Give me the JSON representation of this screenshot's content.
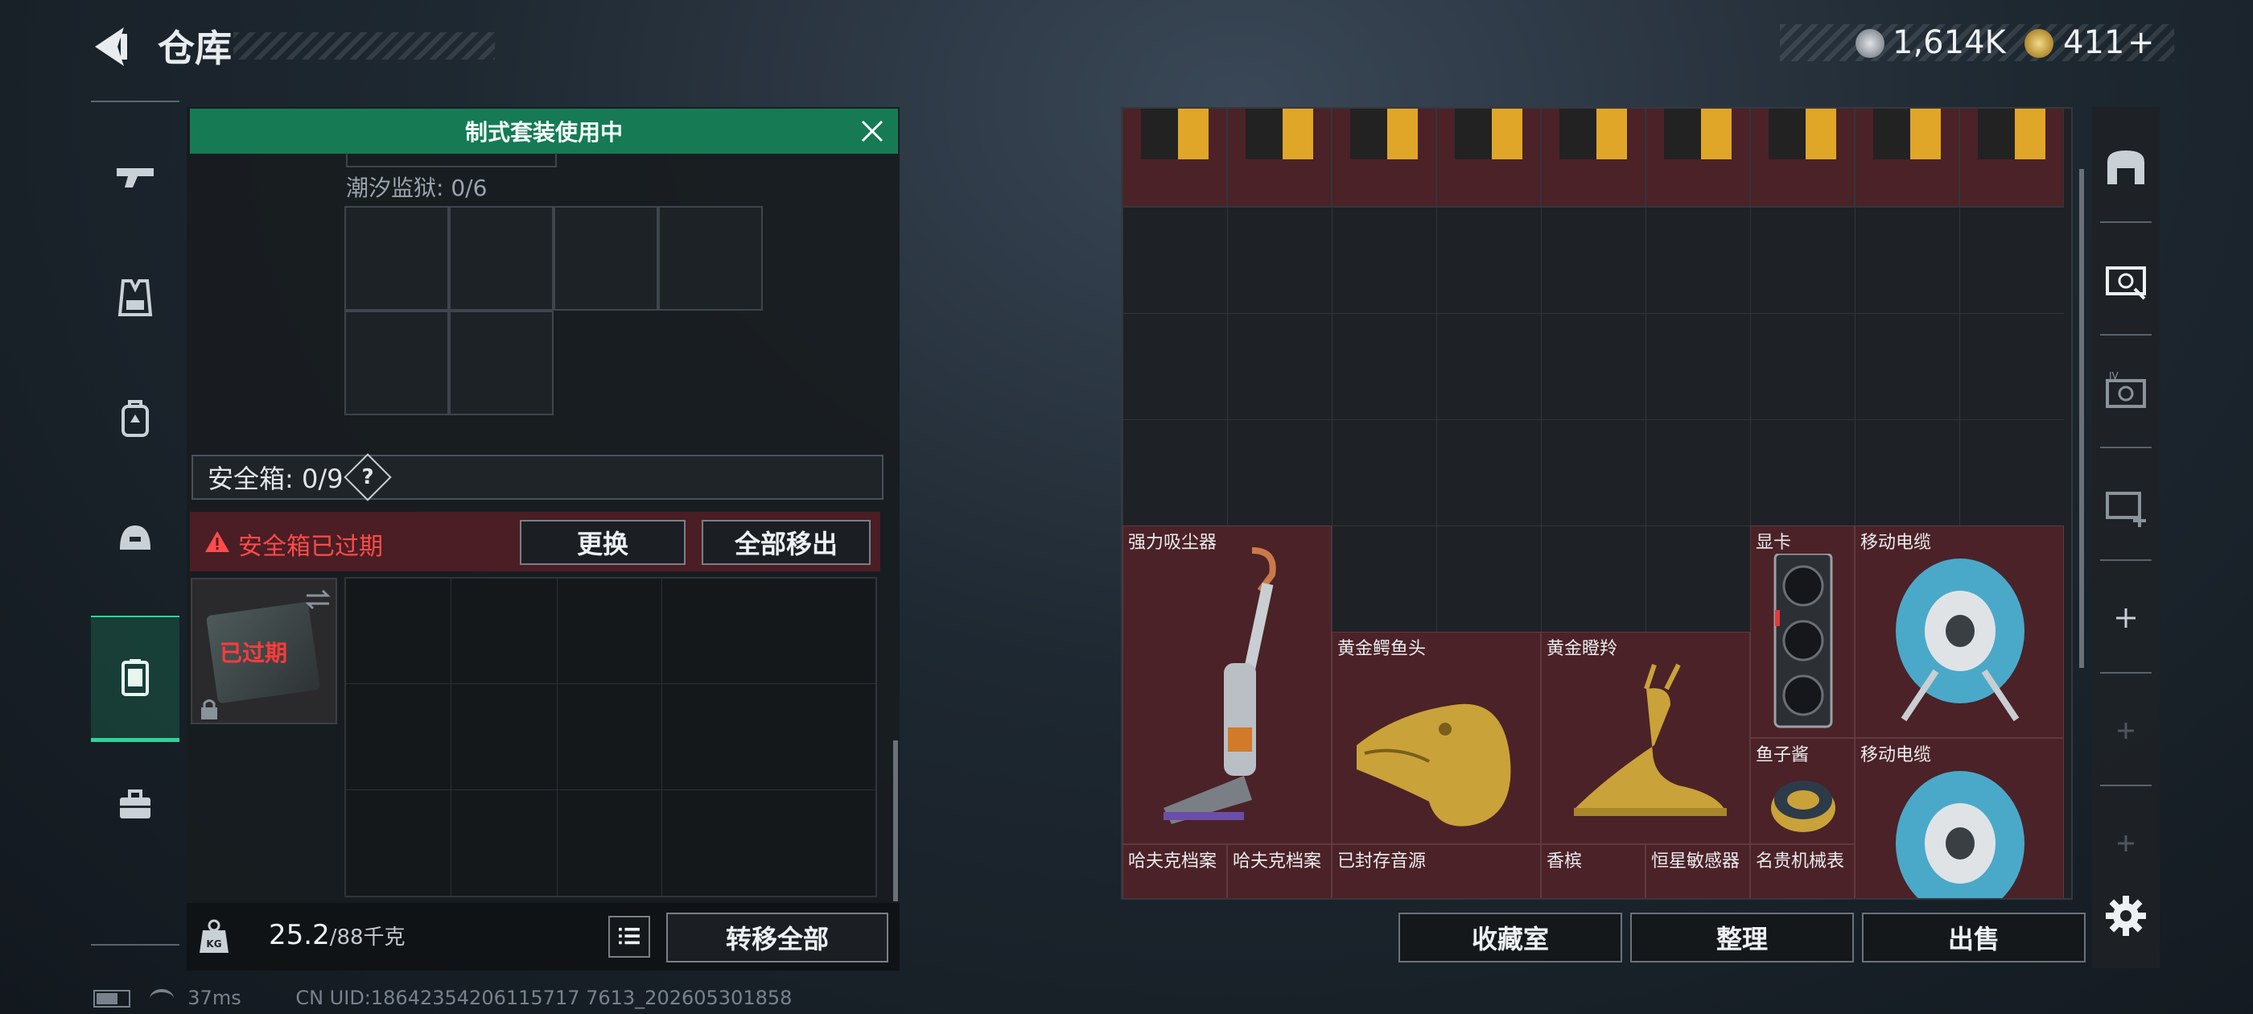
{
  "header": {
    "title": "仓库",
    "currency_1": "1,614K",
    "currency_2": "411",
    "currency_2_plus": "+"
  },
  "left_nav": {
    "items": [
      "weapon-icon",
      "vest-icon",
      "backpack-icon",
      "helmet-icon",
      "safe-box-icon",
      "toolbox-icon"
    ]
  },
  "loadout": {
    "banner": "制式套装使用中",
    "tide_prison_label": "潮汐监狱: 0/6",
    "safe_box_label": "安全箱: 0/9",
    "safe_box_help": "?",
    "warning": "安全箱已过期",
    "replace_button": "更换",
    "remove_all_button": "全部移出",
    "expired_badge": "已过期",
    "weight_current": "25.2",
    "weight_max": "/88千克",
    "transfer_all_button": "转移全部"
  },
  "stash": {
    "items": [
      {
        "name": "强力吸尘器"
      },
      {
        "name": "黄金鳄鱼头"
      },
      {
        "name": "黄金瞪羚"
      },
      {
        "name": "显卡"
      },
      {
        "name": "移动电缆"
      },
      {
        "name": "鱼子酱"
      },
      {
        "name": "移动电缆"
      },
      {
        "name": "哈夫克档案"
      },
      {
        "name": "哈夫克档案"
      },
      {
        "name": "已封存音源"
      },
      {
        "name": "香槟"
      },
      {
        "name": "恒星敏感器"
      },
      {
        "name": "名贵机械表"
      }
    ]
  },
  "footer": {
    "collection_button": "收藏室",
    "organize_button": "整理",
    "sell_button": "出售"
  },
  "status_bar": {
    "ping": "37ms",
    "uid": "CN UID:18642354206115717 7613_202605301858"
  },
  "colors": {
    "accent_green": "#167a55",
    "item_red": "#4b2227",
    "warning_red": "#ff4b4b"
  }
}
